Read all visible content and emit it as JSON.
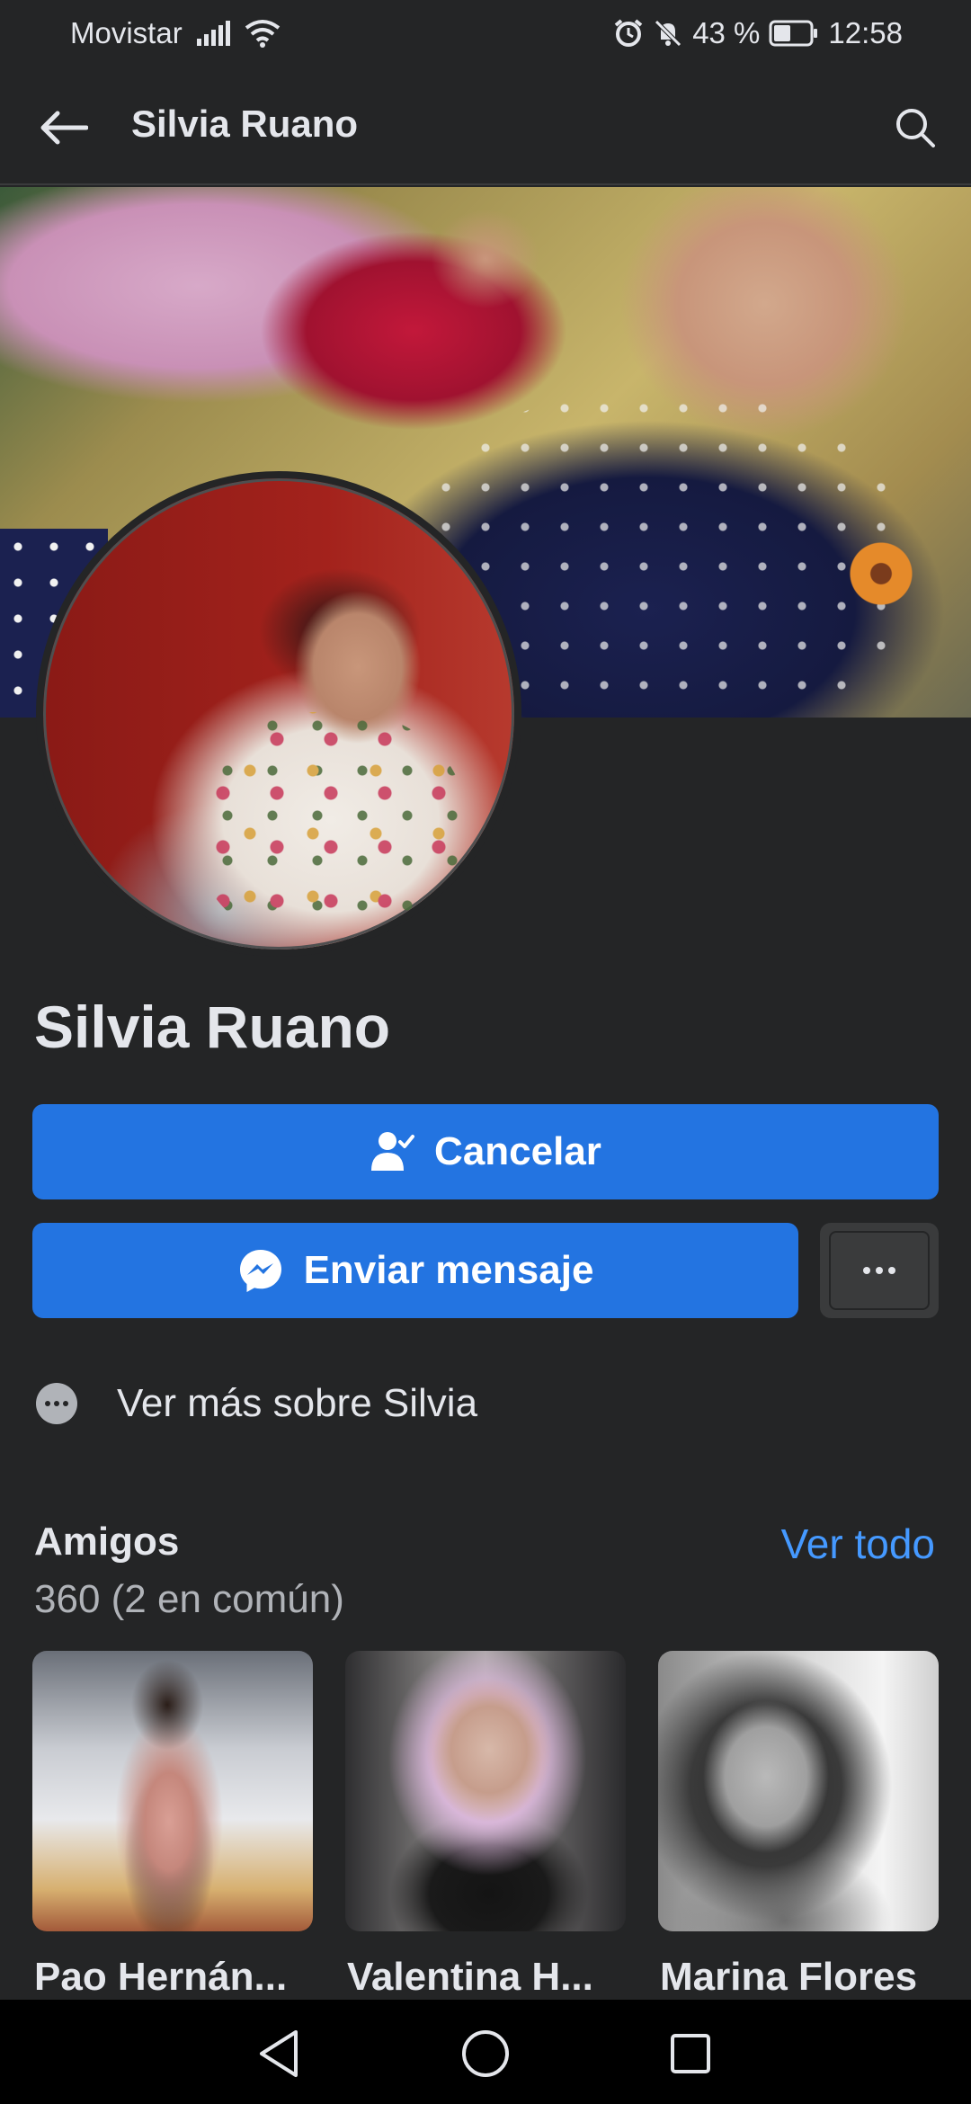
{
  "status_bar": {
    "carrier": "Movistar",
    "battery": "43 %",
    "time": "12:58"
  },
  "app_bar": {
    "title": "Silvia Ruano"
  },
  "profile": {
    "name": "Silvia Ruano",
    "cancel_label": "Cancelar",
    "message_label": "Enviar mensaje",
    "about_label": "Ver más sobre Silvia"
  },
  "friends": {
    "title": "Amigos",
    "count": "360 (2 en común)",
    "see_all": "Ver todo",
    "items": [
      {
        "name": "Pao Hernán..."
      },
      {
        "name": "Valentina H..."
      },
      {
        "name": "Marina Flores"
      }
    ]
  },
  "colors": {
    "background": "#242526",
    "primary_button": "#2374e1",
    "link": "#4599ff",
    "secondary_text": "#b0b3b8"
  },
  "icons": [
    "back-arrow-icon",
    "search-icon",
    "add-friend-check-icon",
    "messenger-icon",
    "more-dots-icon",
    "info-dots-icon",
    "nav-back-icon",
    "nav-home-icon",
    "nav-recent-icon"
  ]
}
